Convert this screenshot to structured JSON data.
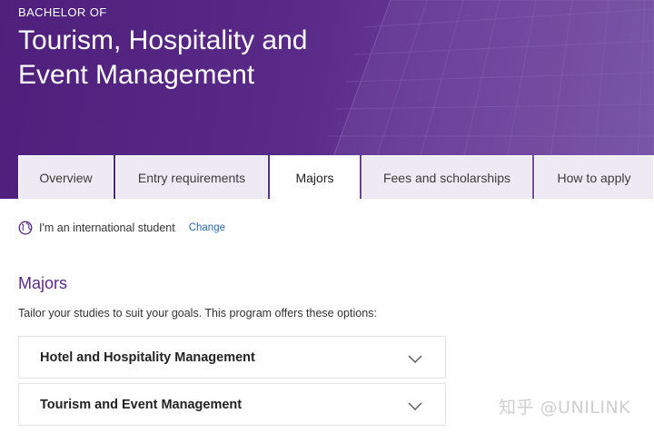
{
  "hero": {
    "eyebrow": "BACHELOR OF",
    "title_line1": "Tourism, Hospitality and",
    "title_line2": "Event Management"
  },
  "tabs": [
    {
      "label": "Overview",
      "active": false
    },
    {
      "label": "Entry requirements",
      "active": false
    },
    {
      "label": "Majors",
      "active": true
    },
    {
      "label": "Fees and scholarships",
      "active": false
    },
    {
      "label": "How to apply",
      "active": false
    }
  ],
  "student": {
    "icon": "globe-icon",
    "text": "I'm an international student",
    "change_label": "Change"
  },
  "majors": {
    "title": "Majors",
    "description": "Tailor your studies to suit your goals. This program offers these options:",
    "items": [
      {
        "label": "Hotel and Hospitality Management",
        "expanded": false
      },
      {
        "label": "Tourism and Event Management",
        "expanded": false
      }
    ]
  },
  "watermark": "知乎 @UNILINK",
  "colors": {
    "brand_purple": "#5a2a88",
    "tab_inactive_bg": "#eeeaf3",
    "link_blue": "#2a68a8"
  }
}
